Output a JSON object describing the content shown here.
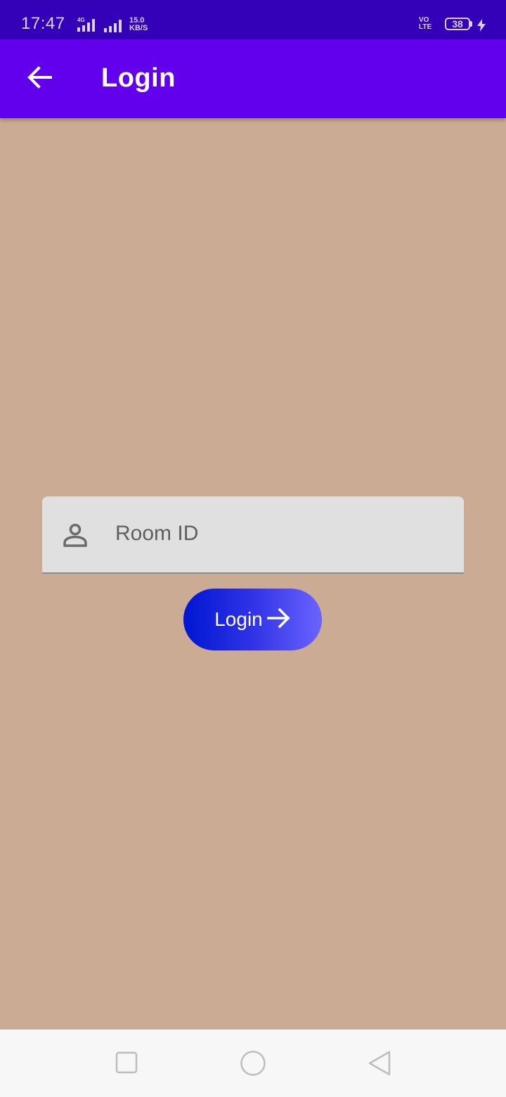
{
  "status_bar": {
    "time": "17:47",
    "network_type": "4G",
    "net_speed_value": "15.0",
    "net_speed_unit": "KB/S",
    "volte_top": "VO",
    "volte_bottom": "LTE",
    "battery_level": "38",
    "icons": [
      "signal-4g-icon",
      "signal-icon",
      "volte-icon",
      "battery-icon",
      "charging-bolt-icon"
    ]
  },
  "app_bar": {
    "title": "Login",
    "back_icon": "arrow-left-icon",
    "color": "#6200ee"
  },
  "form": {
    "room_id_placeholder": "Room ID",
    "room_id_value": "",
    "field_icon": "person-icon",
    "login_label": "Login",
    "login_icon": "arrow-right-icon"
  },
  "nav_bar": {
    "icons": [
      "recents-square-icon",
      "home-circle-icon",
      "back-triangle-icon"
    ]
  },
  "colors": {
    "status_bar": "#3400b8",
    "background": "#cbab94",
    "input_background": "#e0e0e0",
    "button_gradient_start": "#0016d1",
    "button_gradient_end": "#6a63ff"
  }
}
